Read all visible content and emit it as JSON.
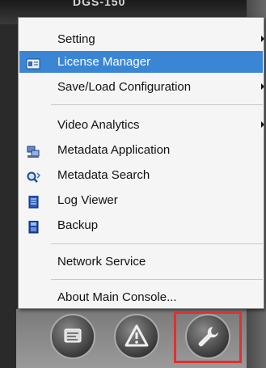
{
  "window": {
    "title": "DGS-150"
  },
  "menu": {
    "items": [
      {
        "label": "Setting",
        "has_submenu": true
      },
      {
        "label": "License Manager",
        "selected": true,
        "icon": "license-icon"
      },
      {
        "label": "Save/Load Configuration",
        "has_submenu": true
      },
      {
        "label": "Video Analytics",
        "has_submenu": true
      },
      {
        "label": "Metadata Application",
        "icon": "metadata-application-icon"
      },
      {
        "label": "Metadata Search",
        "icon": "metadata-search-icon"
      },
      {
        "label": "Log Viewer",
        "icon": "log-viewer-icon"
      },
      {
        "label": "Backup",
        "icon": "backup-icon"
      },
      {
        "label": "Network Service"
      },
      {
        "label": "About Main Console..."
      }
    ]
  },
  "toolbar": {
    "buttons": [
      {
        "icon": "console-icon"
      },
      {
        "icon": "alert-icon"
      },
      {
        "icon": "wrench-icon",
        "highlighted": true
      }
    ]
  },
  "colors": {
    "selection": "#3a86d4",
    "highlight_box": "#e23030"
  }
}
